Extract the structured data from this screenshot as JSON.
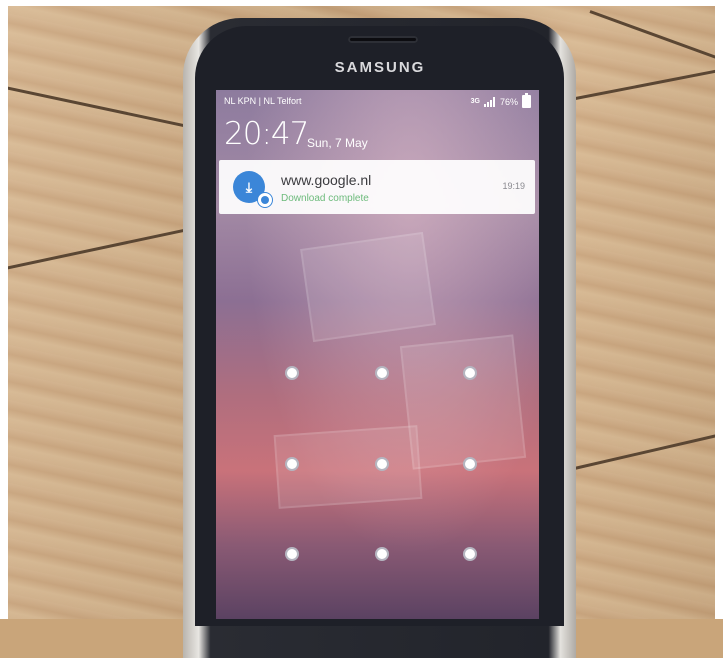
{
  "device": {
    "brand": "SAMSUNG"
  },
  "status_bar": {
    "carrier": "NL KPN | NL Telfort",
    "network_type": "3G",
    "battery_percent": "76%",
    "icons": [
      "signal-icon",
      "battery-icon"
    ]
  },
  "lock_screen": {
    "time": "20:47",
    "date": "Sun, 7 May"
  },
  "notification": {
    "title": "www.google.nl",
    "subtitle": "Download complete",
    "time": "19:19",
    "icon": "download-icon",
    "accent_color": "#3b86d8"
  },
  "pattern_lock": {
    "grid": [
      3,
      3
    ],
    "dot_count": 9
  }
}
